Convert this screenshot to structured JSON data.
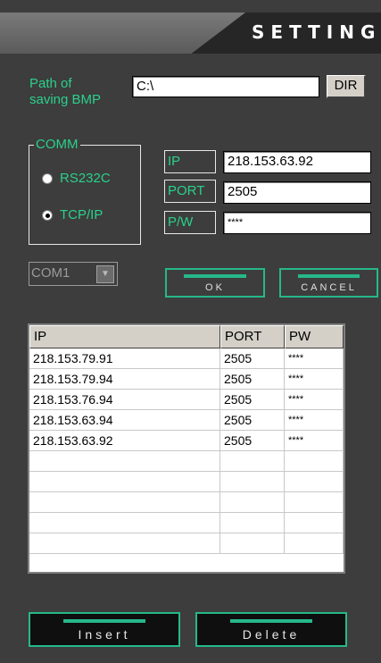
{
  "header": {
    "title": "SETTING"
  },
  "path": {
    "label_line1": "Path of",
    "label_line2": "saving BMP",
    "value": "C:\\",
    "dir_button": "DIR"
  },
  "comm": {
    "legend": "COMM",
    "options": [
      {
        "label": "RS232C",
        "selected": false
      },
      {
        "label": "TCP/IP",
        "selected": true
      }
    ]
  },
  "fields": {
    "ip_label": "IP",
    "ip_value": "218.153.63.92",
    "port_label": "PORT",
    "port_value": "2505",
    "pw_label": "P/W",
    "pw_value": "****"
  },
  "com_select": {
    "value": "COM1"
  },
  "buttons": {
    "ok": "OK",
    "cancel": "CANCEL",
    "insert": "Insert",
    "delete": "Delete"
  },
  "table": {
    "columns": [
      "IP",
      "PORT",
      "PW"
    ],
    "rows": [
      [
        "218.153.79.91",
        "2505",
        "****"
      ],
      [
        "218.153.79.94",
        "2505",
        "****"
      ],
      [
        "218.153.76.94",
        "2505",
        "****"
      ],
      [
        "218.153.63.94",
        "2505",
        "****"
      ],
      [
        "218.153.63.92",
        "2505",
        "****"
      ],
      [
        "",
        "",
        ""
      ],
      [
        "",
        "",
        ""
      ],
      [
        "",
        "",
        ""
      ],
      [
        "",
        "",
        ""
      ],
      [
        "",
        "",
        ""
      ]
    ]
  }
}
